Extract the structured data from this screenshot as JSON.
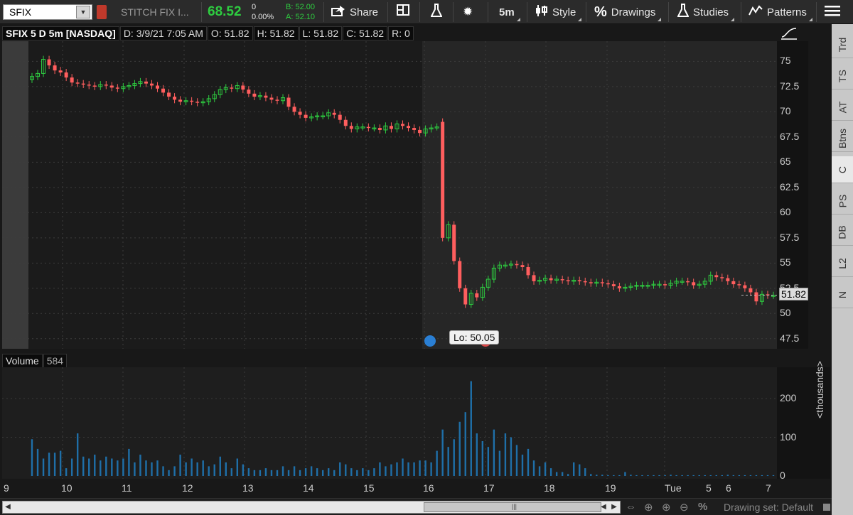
{
  "toolbar": {
    "symbol": "SFIX",
    "company": "STITCH FIX I...",
    "last": "68.52",
    "change": "0",
    "change_pct": "0.00%",
    "bid": "B: 52.00",
    "ask": "A: 52.10",
    "share_label": "Share",
    "timeframe": "5m",
    "style_label": "Style",
    "drawings_label": "Drawings",
    "studies_label": "Studies",
    "patterns_label": "Patterns"
  },
  "header": {
    "title": "SFIX 5 D 5m [NASDAQ]",
    "date": "D: 3/9/21 7:05 AM",
    "open": "O: 51.82",
    "high": "H: 51.82",
    "low": "L: 51.82",
    "close": "C: 51.82",
    "range": "R: 0"
  },
  "side_tabs": [
    "Trd",
    "TS",
    "AT",
    "Btns",
    "C",
    "PS",
    "DB",
    "L2",
    "N"
  ],
  "price_axis": [
    "75",
    "72.5",
    "70",
    "67.5",
    "65",
    "62.5",
    "60",
    "57.5",
    "55",
    "52.5",
    "50",
    "47.5"
  ],
  "last_price_label": "51.82",
  "low_tooltip": "Lo: 50.05",
  "volume": {
    "label": "Volume",
    "value": "584",
    "axis": [
      "200",
      "100",
      "0"
    ],
    "unit": "<thousands>"
  },
  "time_axis": [
    "9",
    "10",
    "11",
    "12",
    "13",
    "14",
    "15",
    "16",
    "17",
    "18",
    "19",
    "Tue",
    "5",
    "6",
    "7"
  ],
  "bottom": {
    "drawing_set": "Drawing set: Default"
  },
  "chart_data": {
    "type": "candlestick",
    "title": "SFIX 5 D 5m [NASDAQ]",
    "ylim": [
      46.5,
      77
    ],
    "volume_ylim": [
      0,
      270
    ],
    "up_color": "#2ecc40",
    "down_color": "#ff5e5e",
    "volume_color": "#1f6fa8",
    "series_close": [
      73.5,
      73.8,
      75.2,
      74.6,
      74.1,
      73.9,
      73.4,
      72.9,
      72.8,
      72.7,
      72.6,
      72.5,
      72.7,
      72.6,
      72.4,
      72.3,
      72.5,
      72.6,
      72.8,
      73.0,
      72.8,
      72.6,
      72.3,
      71.9,
      71.5,
      71.2,
      71.0,
      71.1,
      71.0,
      70.9,
      71.0,
      71.3,
      71.7,
      72.2,
      72.4,
      72.3,
      72.6,
      72.2,
      71.8,
      71.5,
      71.6,
      71.4,
      71.2,
      71.1,
      71.4,
      70.5,
      70.0,
      69.7,
      69.4,
      69.5,
      69.6,
      69.6,
      69.9,
      69.7,
      69.2,
      68.6,
      68.3,
      68.5,
      68.5,
      68.4,
      68.4,
      68.2,
      68.6,
      68.3,
      68.8,
      68.6,
      68.4,
      68.2,
      67.9,
      68.3,
      68.4,
      68.5,
      57.5,
      58.8,
      55.2,
      52.5,
      50.9,
      52.0,
      51.6,
      52.6,
      53.4,
      54.5,
      54.8,
      54.8,
      54.9,
      54.8,
      54.6,
      53.8,
      53.2,
      53.3,
      53.5,
      53.3,
      53.4,
      53.3,
      53.2,
      53.3,
      53.2,
      53.1,
      53.0,
      53.1,
      53.0,
      52.9,
      52.7,
      52.5,
      52.6,
      52.7,
      52.8,
      52.8,
      52.8,
      52.9,
      52.9,
      52.8,
      53.0,
      53.2,
      53.2,
      53.1,
      52.8,
      52.9,
      53.2,
      53.8,
      53.6,
      53.5,
      53.2,
      52.9,
      52.8,
      52.5,
      52.1,
      51.2,
      51.9,
      51.8,
      51.8
    ],
    "series_open": [
      73.2,
      73.5,
      73.8,
      75.2,
      74.6,
      74.1,
      73.9,
      73.4,
      72.9,
      72.8,
      72.7,
      72.6,
      72.5,
      72.7,
      72.6,
      72.4,
      72.3,
      72.5,
      72.6,
      72.8,
      73.0,
      72.8,
      72.6,
      72.3,
      71.9,
      71.5,
      71.2,
      71.0,
      71.1,
      71.0,
      70.9,
      71.0,
      71.3,
      71.7,
      72.2,
      72.4,
      72.3,
      72.6,
      72.2,
      71.8,
      71.5,
      71.6,
      71.4,
      71.2,
      71.1,
      71.4,
      70.5,
      70.0,
      69.7,
      69.4,
      69.5,
      69.6,
      69.6,
      69.9,
      69.7,
      69.2,
      68.6,
      68.3,
      68.5,
      68.5,
      68.4,
      68.4,
      68.2,
      68.6,
      68.3,
      68.8,
      68.6,
      68.4,
      68.2,
      67.9,
      68.3,
      68.5,
      69.0,
      57.5,
      58.8,
      55.2,
      52.5,
      50.9,
      52.0,
      51.6,
      52.6,
      53.4,
      54.5,
      54.8,
      54.8,
      54.9,
      54.8,
      54.6,
      53.8,
      53.2,
      53.3,
      53.5,
      53.3,
      53.4,
      53.3,
      53.2,
      53.3,
      53.2,
      53.1,
      53.0,
      53.1,
      53.0,
      52.9,
      52.7,
      52.5,
      52.6,
      52.7,
      52.8,
      52.8,
      52.8,
      52.9,
      52.9,
      52.8,
      53.0,
      53.2,
      53.2,
      53.1,
      52.8,
      52.9,
      53.2,
      53.8,
      53.6,
      53.5,
      53.2,
      52.9,
      52.8,
      52.5,
      52.1,
      51.2,
      51.9,
      51.8
    ],
    "series_volume": [
      95,
      70,
      45,
      60,
      60,
      65,
      20,
      45,
      110,
      50,
      45,
      55,
      40,
      50,
      45,
      40,
      45,
      70,
      35,
      55,
      40,
      35,
      40,
      25,
      15,
      25,
      55,
      35,
      45,
      35,
      40,
      25,
      30,
      50,
      35,
      20,
      45,
      30,
      20,
      15,
      15,
      20,
      15,
      15,
      25,
      15,
      25,
      15,
      20,
      25,
      20,
      15,
      20,
      15,
      35,
      30,
      20,
      15,
      20,
      15,
      20,
      35,
      25,
      30,
      35,
      45,
      35,
      35,
      40,
      40,
      35,
      65,
      120,
      75,
      95,
      140,
      165,
      245,
      110,
      90,
      75,
      120,
      65,
      110,
      100,
      80,
      55,
      70,
      40,
      25,
      35,
      20,
      10,
      10,
      5,
      35,
      30,
      20,
      5,
      3,
      3,
      2,
      2,
      2,
      10,
      3,
      2,
      2,
      2,
      2,
      2,
      2,
      3,
      2,
      2,
      2,
      2,
      2,
      2,
      2,
      2,
      2,
      3,
      2,
      2,
      2,
      2,
      2,
      2,
      2,
      2,
      2,
      3,
      3,
      2
    ]
  }
}
